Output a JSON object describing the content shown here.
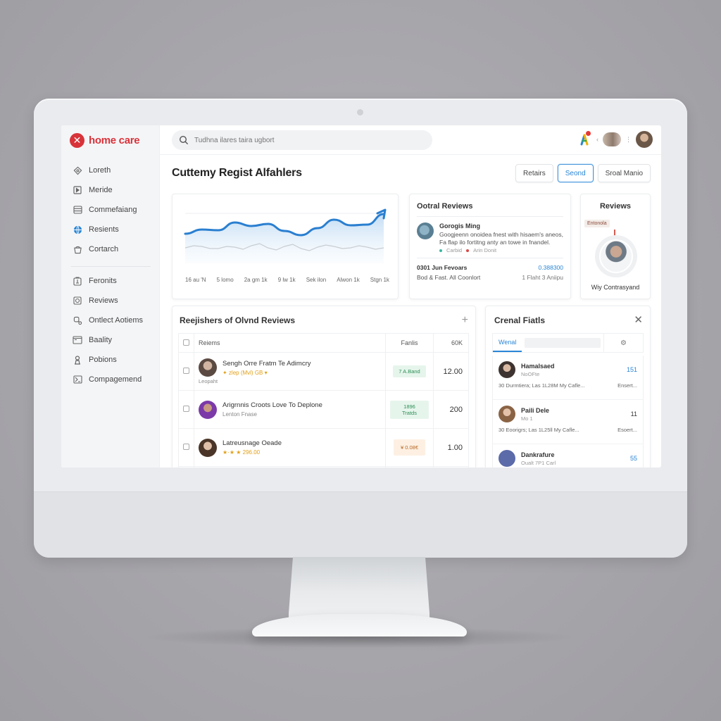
{
  "app": {
    "brand_name": "home care",
    "brand_logo_glyph": "✕",
    "accent": "#2a86d6",
    "brand_color": "#d8333a"
  },
  "sidebar": {
    "items": [
      {
        "label": "Loreth",
        "icon": "home-icon"
      },
      {
        "label": "Meride",
        "icon": "media-icon"
      },
      {
        "label": "Commefaiang",
        "icon": "list-icon"
      },
      {
        "label": "Resients",
        "icon": "globe-icon",
        "active": true
      },
      {
        "label": "Cortarch",
        "icon": "bucket-icon"
      }
    ],
    "items_secondary": [
      {
        "label": "Feronits",
        "icon": "clipboard-icon"
      },
      {
        "label": "Reviews",
        "icon": "review-icon"
      },
      {
        "label": "Ontlect Aotiems",
        "icon": "search-person-icon"
      },
      {
        "label": "Baality",
        "icon": "folder-icon"
      },
      {
        "label": "Pobions",
        "icon": "person-icon"
      },
      {
        "label": "Compagemend",
        "icon": "map-icon"
      }
    ]
  },
  "topbar": {
    "search_placeholder": "Tudhna ilares taira ugbort",
    "notification_count": "1"
  },
  "main": {
    "title": "Cuttemy Regist Alfahlers",
    "buttons": [
      {
        "label": "Retairs",
        "primary": false
      },
      {
        "label": "Seond",
        "primary": true
      },
      {
        "label": "Sroal Manio",
        "primary": false
      }
    ]
  },
  "chart_data": {
    "type": "line",
    "title": "",
    "x": [
      "16 au 'N",
      "5 lomo",
      "2a gm 1k",
      "9 lw 1k",
      "Sek ilon",
      "Alwon 1k",
      "Stgn 1k"
    ],
    "series": [
      {
        "name": "primary",
        "color": "#2a7fd0",
        "values": [
          42,
          48,
          47,
          58,
          53,
          56,
          46,
          40,
          50,
          62,
          54,
          55,
          70
        ]
      },
      {
        "name": "baseline",
        "color": "#c8cdd2",
        "values": [
          22,
          24,
          21,
          23,
          25,
          22,
          24,
          21,
          23,
          24,
          22,
          23,
          22
        ]
      }
    ],
    "ylim": [
      0,
      80
    ],
    "grid": true,
    "trend_arrow": true
  },
  "overall_reviews": {
    "title": "Ootral Reviews",
    "review": {
      "name": "Gorogis Ming",
      "text": "Googjeenn onoidea fnest with hisaem's aneos, Fa flap ilo fortitng anty an towe in fnandel.",
      "meta_left": "Carbid",
      "meta_right": "Arin Donit"
    },
    "stats_left_title": "0301 Jun Fevoars",
    "stats_left_sub": "Bod & Fast. All Coonlort",
    "stats_right_value": "0.388300",
    "stats_right_sub": "1 Flaht 3 Aniipu"
  },
  "profile": {
    "title": "Reviews",
    "tag": "Entonola",
    "name": "Wiy Contrasyand"
  },
  "table": {
    "title": "Reejishers of Olvnd Reviews",
    "columns": [
      "Reiems",
      "Fanlis",
      "60K"
    ],
    "rows": [
      {
        "title": "Sengh Orre Fratm Te Adimcry",
        "sub": "✦ zlep (Mvl) GB ▾",
        "extra": "Leopaht",
        "pill": "7 A.Band",
        "pill_style": "green",
        "value": "12.00",
        "avatar": "#5b4a42"
      },
      {
        "title": "Arigrnnis Croots Love To Deplone",
        "sub": "Lenton Fnase",
        "sub_gray": true,
        "extra": "",
        "pill": "1896 Tratds",
        "pill_style": "green",
        "value": "200",
        "avatar": "#7b3aa8"
      },
      {
        "title": "Latreusnage Oeade",
        "sub": "★·★ ★ 296.00",
        "extra": "",
        "pill": "¥ 0.08€",
        "pill_style": "peach",
        "value": "1.00",
        "avatar": "#4a3528"
      }
    ]
  },
  "contacts": {
    "title": "Crenal Fiatls",
    "active_tab": "Wenal",
    "items": [
      {
        "name": "Hamalsaed",
        "sub": "NoOFte",
        "count": "151",
        "count_style": "blue",
        "detail": "30 Durmtiera; Las 1L28M My Cafle...",
        "action": "Ensert...",
        "avatar": "#3d3330"
      },
      {
        "name": "Paili Dele",
        "sub": "Mo 1",
        "count": "11",
        "count_style": "dark",
        "detail": "30 Eoorigrs; Las 1L25ll My Cafle...",
        "action": "Esoert...",
        "avatar": "#8a6345"
      },
      {
        "name": "Dankrafure",
        "sub": "Oualt 7P1 Carl",
        "count": "55",
        "count_style": "blue",
        "detail": "",
        "action": "",
        "avatar": "#5b6aa8"
      }
    ]
  }
}
